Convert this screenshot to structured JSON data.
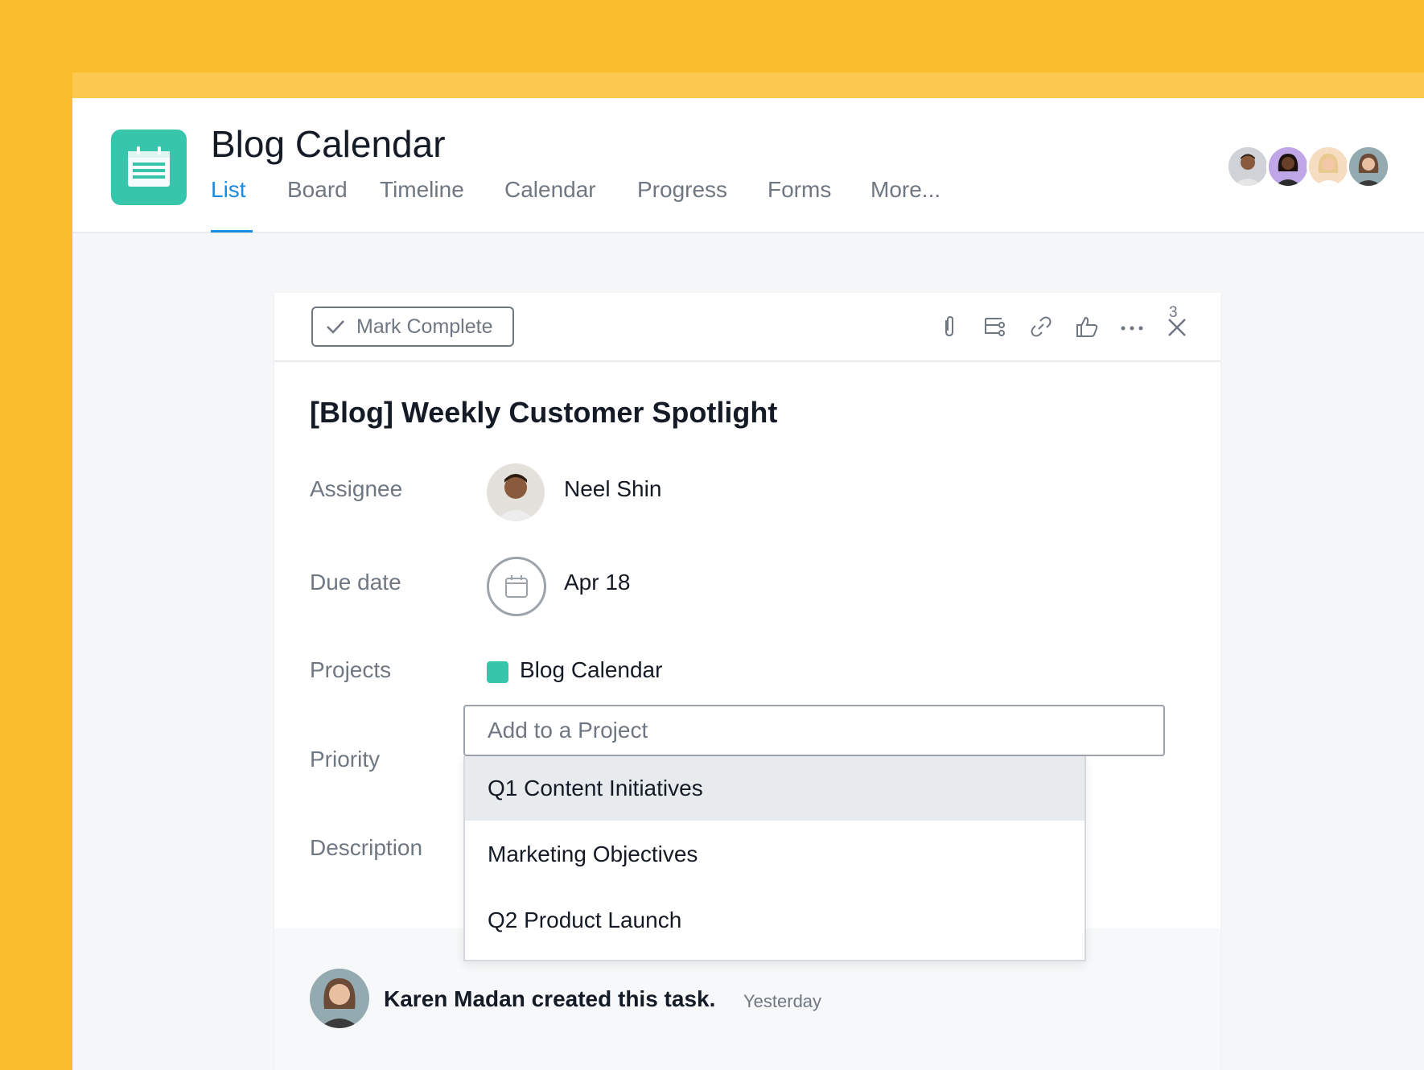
{
  "header": {
    "project_title": "Blog Calendar",
    "tabs": [
      {
        "label": "List",
        "active": true
      },
      {
        "label": "Board"
      },
      {
        "label": "Timeline"
      },
      {
        "label": "Calendar"
      },
      {
        "label": "Progress"
      },
      {
        "label": "Forms"
      },
      {
        "label": "More..."
      }
    ],
    "members_count": 4
  },
  "task": {
    "mark_complete_label": "Mark Complete",
    "like_count": "3",
    "title": "[Blog] Weekly Customer Spotlight",
    "fields": {
      "assignee_label": "Assignee",
      "assignee_name": "Neel Shin",
      "due_label": "Due date",
      "due_value": "Apr 18",
      "projects_label": "Projects",
      "project_name": "Blog Calendar",
      "priority_label": "Priority",
      "description_label": "Description"
    },
    "add_project_placeholder": "Add to a Project"
  },
  "dropdown": {
    "items": [
      {
        "label": "Q1 Content Initiatives",
        "highlighted": true
      },
      {
        "label": "Marketing Objectives"
      },
      {
        "label": "Q2 Product Launch"
      }
    ]
  },
  "activity": {
    "text": "Karen Madan created this task.",
    "time": "Yesterday"
  },
  "colors": {
    "background": "#FABD2E",
    "accent": "#1A8CE0",
    "project_color": "#37C5AB"
  }
}
